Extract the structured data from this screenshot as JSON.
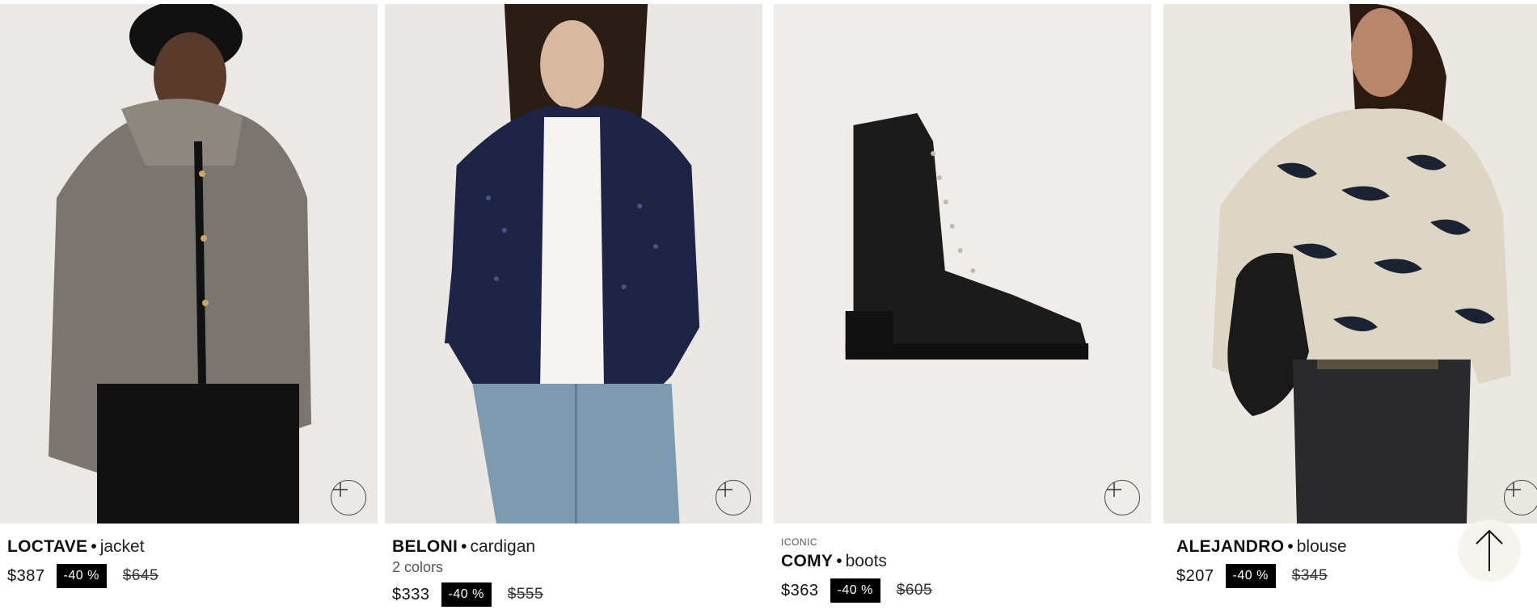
{
  "products": [
    {
      "tag": "",
      "name": "LOCTAVE",
      "separator": "•",
      "type": "jacket",
      "colors": "",
      "price": "$387",
      "discount": "-40 %",
      "old_price": "$645",
      "image_icon": "jacket-model-photo",
      "add_icon": "plus-icon"
    },
    {
      "tag": "",
      "name": "BELONI",
      "separator": "•",
      "type": "cardigan",
      "colors": "2 colors",
      "price": "$333",
      "discount": "-40 %",
      "old_price": "$555",
      "image_icon": "cardigan-model-photo",
      "add_icon": "plus-icon"
    },
    {
      "tag": "ICONIC",
      "name": "COMY",
      "separator": "•",
      "type": "boots",
      "colors": "",
      "price": "$363",
      "discount": "-40 %",
      "old_price": "$605",
      "image_icon": "boot-product-photo",
      "add_icon": "plus-icon"
    },
    {
      "tag": "",
      "name": "ALEJANDRO",
      "separator": "•",
      "type": "blouse",
      "colors": "",
      "price": "$207",
      "discount": "-40 %",
      "old_price": "$345",
      "image_icon": "blouse-model-photo",
      "add_icon": "plus-icon"
    }
  ],
  "scroll_top": {
    "icon": "arrow-up-icon"
  },
  "colors": {
    "badge_bg": "#000000",
    "badge_text": "#ffffff",
    "photo_bg": "#efedea",
    "scroll_top_bg": "#f7f3ef"
  }
}
